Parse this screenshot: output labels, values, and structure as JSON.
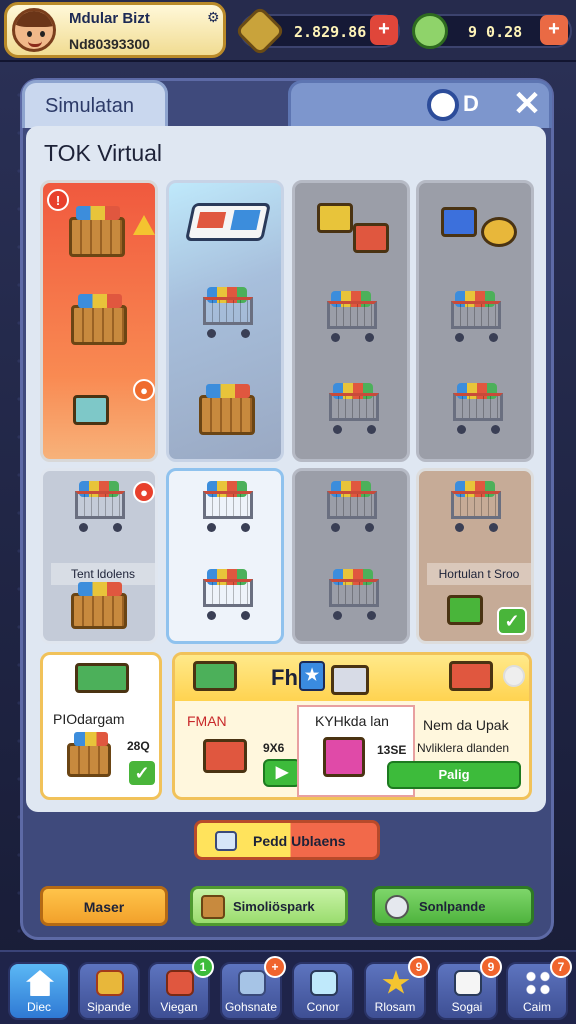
{
  "player": {
    "name": "Mdular Bizt",
    "id": "Nd80393300"
  },
  "resources": {
    "coins": "2.829.86",
    "gems": "9 0.28"
  },
  "panel": {
    "tab": "Simulatan",
    "store_title": "TOK Virtual"
  },
  "grid_labels": {
    "cell_a": "Tent ldolens",
    "cell_b": "Hortulan t Sroo"
  },
  "cards": {
    "promo_title": "Fh",
    "card1_title": "PIOdargam",
    "card1_price": "28Q",
    "card2_title": "FMAN",
    "card2_price": "9X6",
    "card3_title": "KYHkda lan",
    "card3_price": "13SE",
    "card4_title": "Nem da Upak",
    "card4_sub": "Nvliklera dlanden",
    "card4_button": "Palig"
  },
  "buttons": {
    "primary": "Pedd Ublaens",
    "left": "Maser",
    "middle": "Simoliöspark",
    "right": "Sonlpande"
  },
  "nav": [
    {
      "label": "Diec"
    },
    {
      "label": "Sipande",
      "badge": ""
    },
    {
      "label": "Viegan",
      "badge": "1"
    },
    {
      "label": "Gohsnate",
      "badge": "+"
    },
    {
      "label": "Conor",
      "badge": ""
    },
    {
      "label": "Rlosam",
      "badge": "9"
    },
    {
      "label": "Sogai",
      "badge": "9"
    },
    {
      "label": "Caim",
      "badge": "7"
    }
  ],
  "colors": {
    "accent": "#f1c25a",
    "green": "#3dbb3b",
    "red": "#f0593e",
    "panel": "#3f4a7c"
  }
}
